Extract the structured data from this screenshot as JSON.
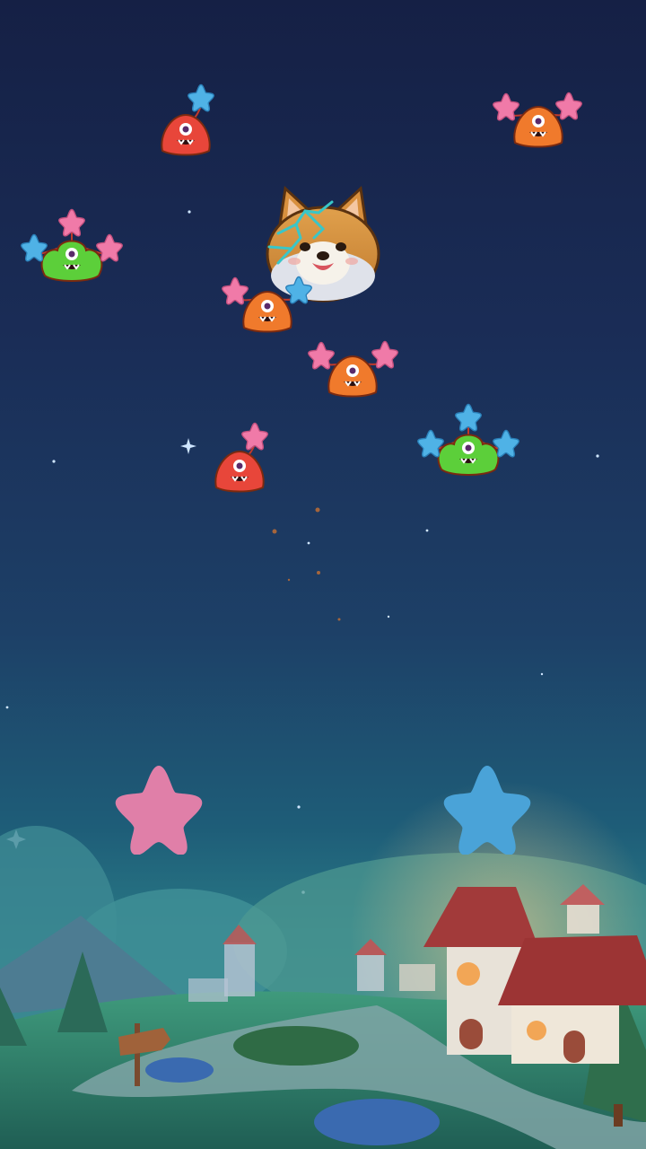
{
  "game": {
    "scene": "night-village",
    "boss": {
      "icon": "shiba-dog-boss",
      "status": "cracked"
    },
    "controls": [
      {
        "icon": "pink-star-button",
        "color": "#e07fa8"
      },
      {
        "icon": "blue-star-button",
        "color": "#4aa3d8"
      }
    ],
    "monsters": [
      {
        "kind": "red-blob",
        "balloons": [
          "blue"
        ]
      },
      {
        "kind": "orange-blob",
        "balloons": [
          "pink",
          "pink"
        ]
      },
      {
        "kind": "green-blob",
        "balloons": [
          "blue",
          "pink",
          "pink"
        ]
      },
      {
        "kind": "orange-blob",
        "balloons": [
          "pink",
          "blue"
        ]
      },
      {
        "kind": "orange-blob",
        "balloons": [
          "pink",
          "pink"
        ]
      },
      {
        "kind": "red-blob",
        "balloons": [
          "pink"
        ]
      },
      {
        "kind": "green-blob",
        "balloons": [
          "blue",
          "blue",
          "blue"
        ]
      }
    ],
    "colors": {
      "pink": "#f07aa8",
      "blue": "#4fb2e6",
      "red_monster": "#e8463a",
      "orange_monster": "#f07a2c",
      "green_monster": "#5ccf3a",
      "sky_top": "#152045",
      "sky_bottom": "#2a7b86"
    }
  }
}
